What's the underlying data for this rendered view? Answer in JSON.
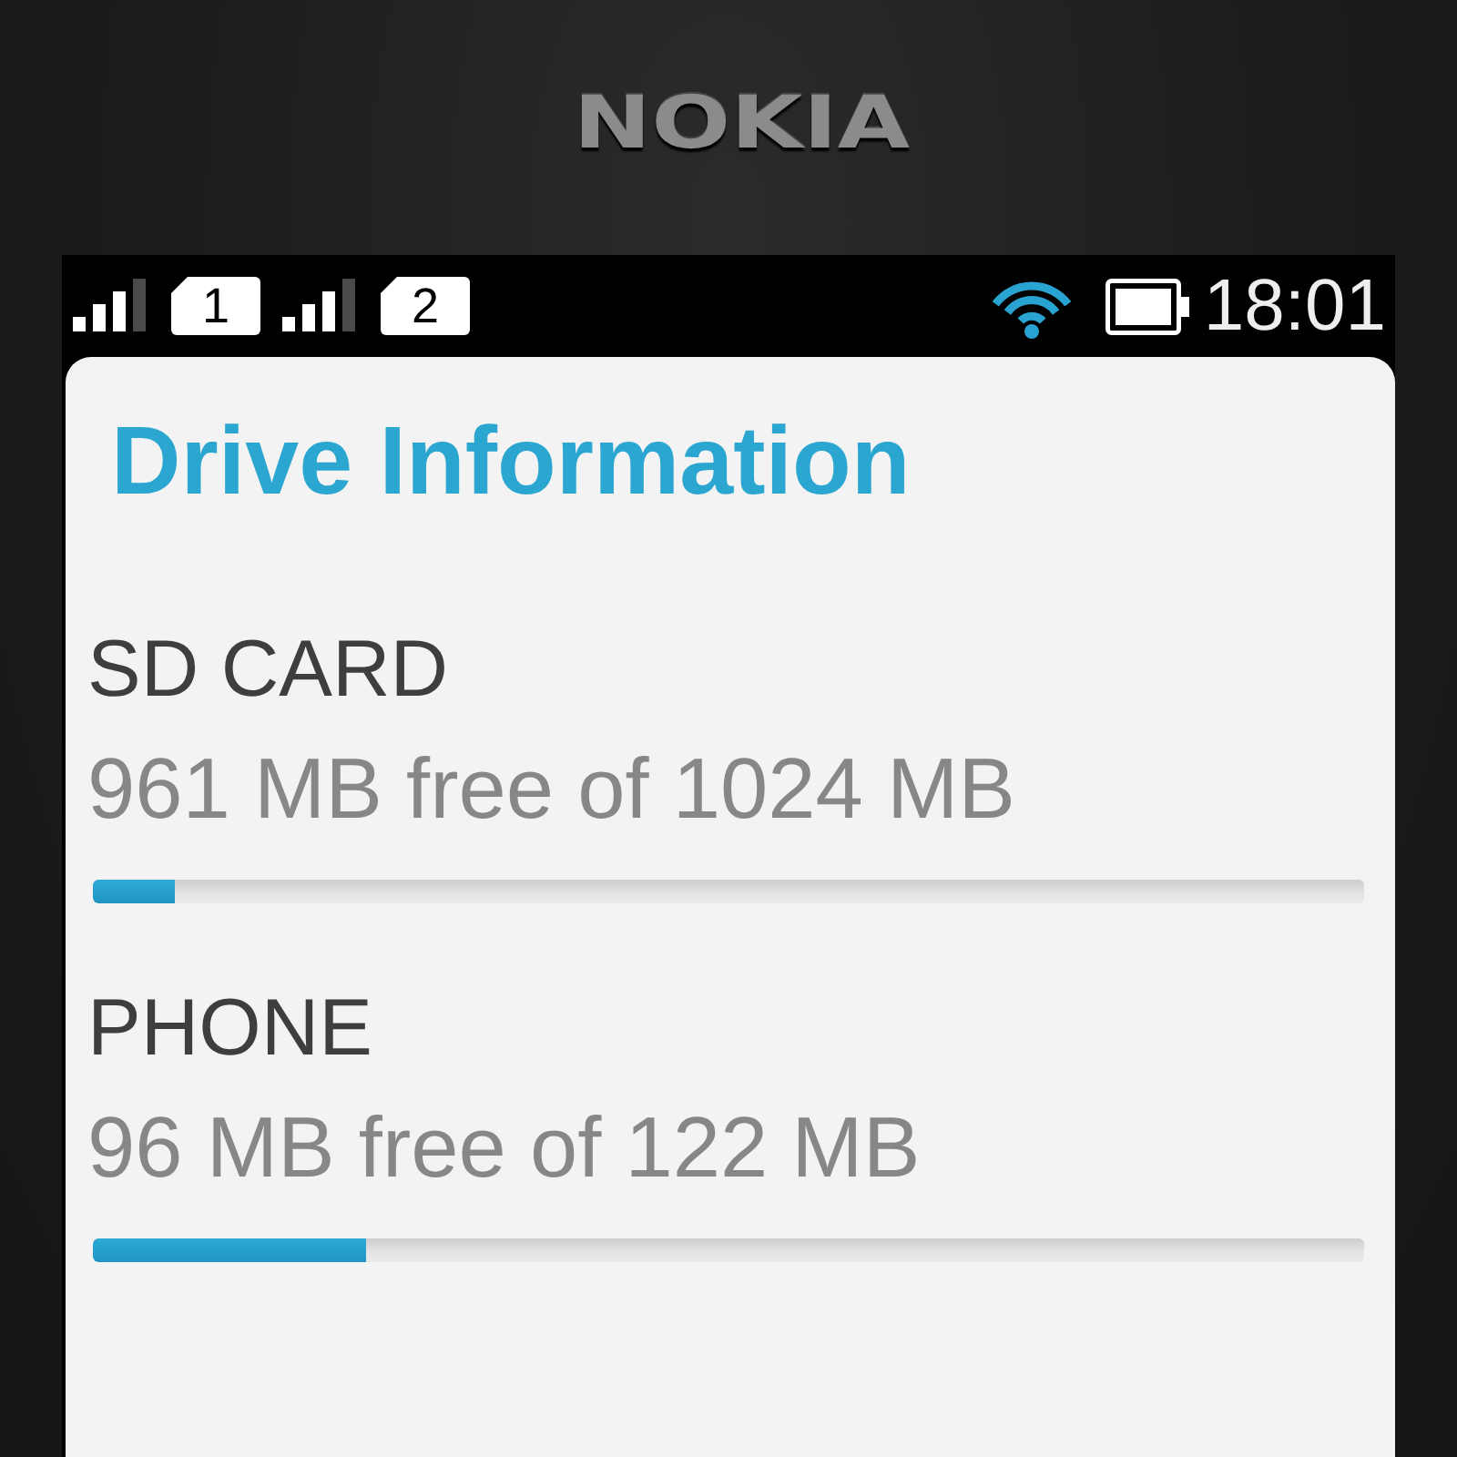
{
  "device": {
    "logo": "NOKIA"
  },
  "status_bar": {
    "sims": [
      {
        "slot": "1"
      },
      {
        "slot": "2"
      }
    ],
    "time": "18:01"
  },
  "title": "Drive Information",
  "drives": [
    {
      "name": "SD CARD",
      "detail": "961 MB free of 1024 MB",
      "level": 0.065
    },
    {
      "name": "PHONE",
      "detail": "96 MB free of 122 MB",
      "level": 0.215
    }
  ]
}
